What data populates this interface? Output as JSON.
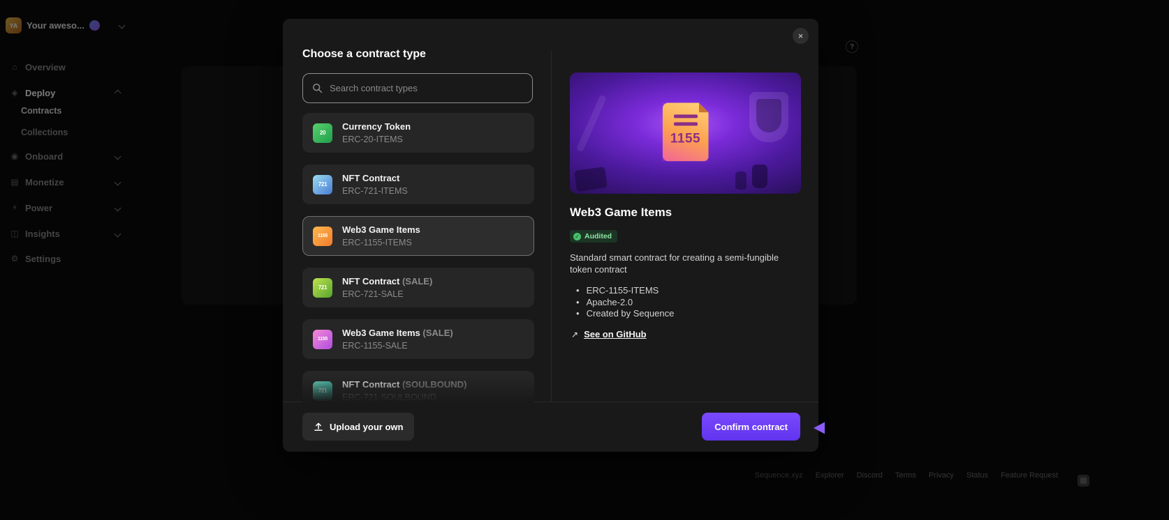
{
  "colors": {
    "accent_purple": "#6c3ef8",
    "audited_green": "#8fe3a4",
    "modal_bg": "#191919",
    "selected_border": "#707070"
  },
  "icons": {
    "overview": "⌂",
    "deploy": "◈",
    "onboard": "◉",
    "monetize": "▤",
    "power": "⚡",
    "insights": "◫",
    "settings": "⚙",
    "close": "×",
    "check": "✓",
    "external": "↗",
    "bullet": "•",
    "help": "?"
  },
  "sidebar": {
    "workspace": {
      "initials": "YA",
      "name": "Your aweso..."
    },
    "items": [
      {
        "label": "Overview"
      },
      {
        "label": "Deploy"
      },
      {
        "label": "Contracts"
      },
      {
        "label": "Collections"
      },
      {
        "label": "Onboard"
      },
      {
        "label": "Monetize"
      },
      {
        "label": "Power"
      },
      {
        "label": "Insights"
      },
      {
        "label": "Settings"
      }
    ]
  },
  "modal": {
    "title": "Choose a contract type",
    "search_placeholder": "Search contract types",
    "contracts": [
      {
        "name": "Currency Token",
        "code": "ERC-20-ITEMS",
        "icon_text": "20"
      },
      {
        "name": "NFT Contract",
        "code": "ERC-721-ITEMS",
        "icon_text": "721"
      },
      {
        "name": "Web3 Game Items",
        "code": "ERC-1155-ITEMS",
        "icon_text": "1155",
        "selected": true
      },
      {
        "name": "NFT Contract",
        "suffix": "(SALE)",
        "code": "ERC-721-SALE",
        "icon_text": "721"
      },
      {
        "name": "Web3 Game Items",
        "suffix": "(SALE)",
        "code": "ERC-1155-SALE",
        "icon_text": "1155"
      },
      {
        "name": "NFT Contract",
        "suffix": "(SOULBOUND)",
        "code": "ERC-721-SOULBOUND",
        "icon_text": "721"
      }
    ],
    "detail": {
      "title": "Web3 Game Items",
      "badge": "Audited",
      "description": "Standard smart contract for creating a semi-fungible token contract",
      "bullets": [
        "ERC-1155-ITEMS",
        "Apache-2.0",
        "Created by Sequence"
      ],
      "github_link": "See on GitHub",
      "illustration_number": "1155"
    },
    "footer": {
      "upload_label": "Upload your own",
      "confirm_label": "Confirm contract"
    }
  },
  "site_footer": {
    "links": [
      "Sequence.xyz",
      "Explorer",
      "Discord",
      "Terms",
      "Privacy",
      "Status",
      "Feature Request"
    ]
  }
}
